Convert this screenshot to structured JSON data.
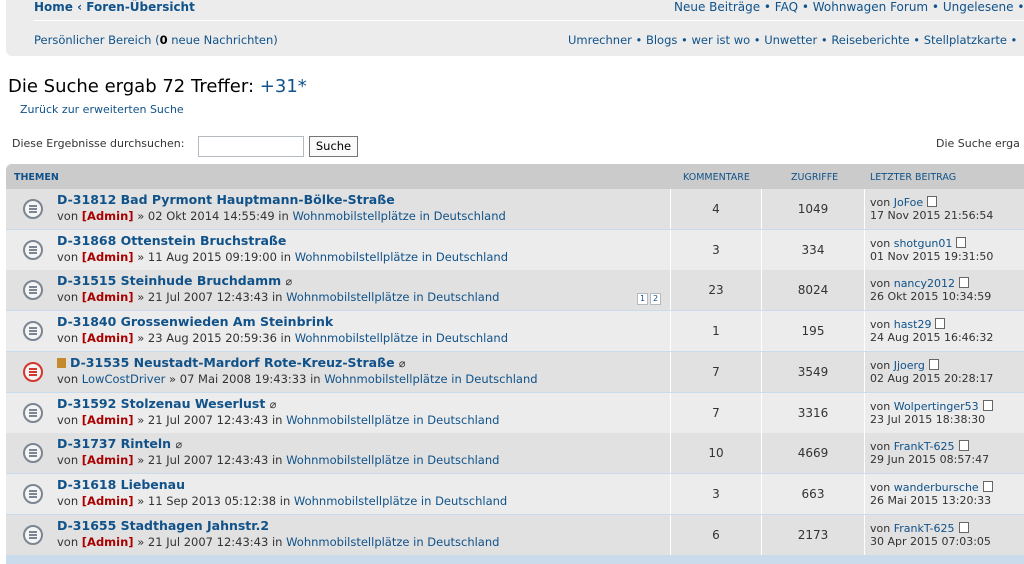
{
  "nav": {
    "home": "Home",
    "sep": "‹",
    "forum_index": "Foren-Übersicht",
    "right_links": "Neue Beiträge • FAQ • Wohnwagen Forum • Ungelesene • Eigene",
    "personal_prefix": "Persönlicher Bereich (",
    "personal_count": "0",
    "personal_suffix": " neue Nachrichten)",
    "right_links2": "Umrechner • Blogs • wer ist wo • Unwetter • Reiseberichte • Stellplatzkarte •"
  },
  "search": {
    "title": "Die Suche ergab 72 Treffer:",
    "terms": "+31*",
    "back": "Zurück zur erweiterten Suche",
    "filter_label": "Diese Ergebnisse durchsuchen:",
    "filter_value": "",
    "filter_button": "Suche",
    "result_count": "Die Suche erga"
  },
  "table": {
    "headers": {
      "topics": "THEMEN",
      "comments": "KOMMENTARE",
      "views": "ZUGRIFFE",
      "last_post": "LETZTER BEITRAG"
    },
    "rows": [
      {
        "title": "D-31812 Bad Pyrmont Hauptmann-Bölke-Straße",
        "attach": "",
        "sticky": false,
        "hot": false,
        "by": "von ",
        "author": "[Admin]",
        "admin": true,
        "date": " » 02 Okt 2014 14:55:49 in ",
        "forum": "Wohnmobilstellplätze in Deutschland",
        "pages": [],
        "comments": "4",
        "views": "1049",
        "last_by": "von ",
        "last_user": "JoFoe",
        "last_date": "17 Nov 2015 21:56:54"
      },
      {
        "title": "D-31868 Ottenstein Bruchstraße",
        "attach": "",
        "sticky": false,
        "hot": false,
        "by": "von ",
        "author": "[Admin]",
        "admin": true,
        "date": " » 11 Aug 2015 09:19:00 in ",
        "forum": "Wohnmobilstellplätze in Deutschland",
        "pages": [],
        "comments": "3",
        "views": "334",
        "last_by": "von ",
        "last_user": "shotgun01",
        "last_date": "01 Nov 2015 19:31:50"
      },
      {
        "title": "D-31515 Steinhude Bruchdamm",
        "attach": "⌀",
        "sticky": false,
        "hot": false,
        "by": "von ",
        "author": "[Admin]",
        "admin": true,
        "date": " » 21 Jul 2007 12:43:43 in ",
        "forum": "Wohnmobilstellplätze in Deutschland",
        "pages": [
          "1",
          "2"
        ],
        "comments": "23",
        "views": "8024",
        "last_by": "von ",
        "last_user": "nancy2012",
        "last_date": "26 Okt 2015 10:34:59"
      },
      {
        "title": "D-31840 Grossenwieden Am Steinbrink",
        "attach": "",
        "sticky": false,
        "hot": false,
        "by": "von ",
        "author": "[Admin]",
        "admin": true,
        "date": " » 23 Aug 2015 20:59:36 in ",
        "forum": "Wohnmobilstellplätze in Deutschland",
        "pages": [],
        "comments": "1",
        "views": "195",
        "last_by": "von ",
        "last_user": "hast29",
        "last_date": "24 Aug 2015 16:46:32"
      },
      {
        "title": "D-31535 Neustadt-Mardorf Rote-Kreuz-Straße",
        "attach": "⌀",
        "sticky": true,
        "hot": true,
        "by": "von ",
        "author": "LowCostDriver",
        "admin": false,
        "date": " » 07 Mai 2008 19:43:33 in ",
        "forum": "Wohnmobilstellplätze in Deutschland",
        "pages": [],
        "comments": "7",
        "views": "3549",
        "last_by": "von ",
        "last_user": "Jjoerg",
        "last_date": "02 Aug 2015 20:28:17"
      },
      {
        "title": "D-31592 Stolzenau Weserlust",
        "attach": "⌀",
        "sticky": false,
        "hot": false,
        "by": "von ",
        "author": "[Admin]",
        "admin": true,
        "date": " » 21 Jul 2007 12:43:43 in ",
        "forum": "Wohnmobilstellplätze in Deutschland",
        "pages": [],
        "comments": "7",
        "views": "3316",
        "last_by": "von ",
        "last_user": "Wolpertinger53",
        "last_date": "23 Jul 2015 18:38:30"
      },
      {
        "title": "D-31737 Rinteln",
        "attach": "⌀",
        "sticky": false,
        "hot": false,
        "by": "von ",
        "author": "[Admin]",
        "admin": true,
        "date": " » 21 Jul 2007 12:43:43 in ",
        "forum": "Wohnmobilstellplätze in Deutschland",
        "pages": [],
        "comments": "10",
        "views": "4669",
        "last_by": "von ",
        "last_user": "FrankT-625",
        "last_date": "29 Jun 2015 08:57:47"
      },
      {
        "title": "D-31618 Liebenau",
        "attach": "",
        "sticky": false,
        "hot": false,
        "by": "von ",
        "author": "[Admin]",
        "admin": true,
        "date": " » 11 Sep 2013 05:12:38 in ",
        "forum": "Wohnmobilstellplätze in Deutschland",
        "pages": [],
        "comments": "3",
        "views": "663",
        "last_by": "von ",
        "last_user": "wanderbursche",
        "last_date": "26 Mai 2015 13:20:33"
      },
      {
        "title": "D-31655 Stadthagen Jahnstr.2",
        "attach": "",
        "sticky": false,
        "hot": false,
        "by": "von ",
        "author": "[Admin]",
        "admin": true,
        "date": " » 21 Jul 2007 12:43:43 in ",
        "forum": "Wohnmobilstellplätze in Deutschland",
        "pages": [],
        "comments": "6",
        "views": "2173",
        "last_by": "von ",
        "last_user": "FrankT-625",
        "last_date": "30 Apr 2015 07:03:05"
      }
    ]
  }
}
